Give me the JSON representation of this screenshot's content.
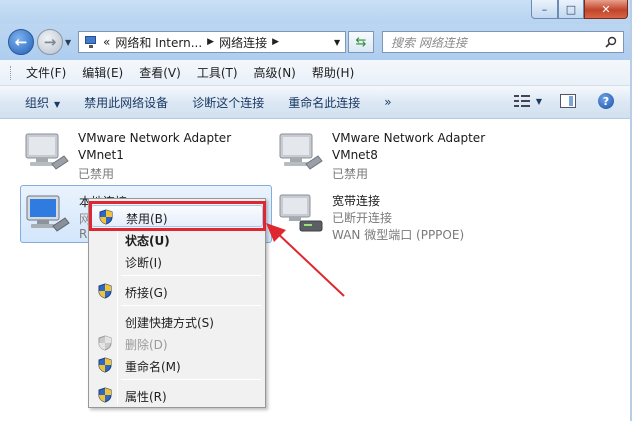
{
  "window": {
    "min_glyph": "–",
    "max_glyph": "□",
    "close_glyph": "✕"
  },
  "address": {
    "prefix": "«",
    "crumbs": [
      "网络和 Intern...",
      "网络连接"
    ],
    "search_placeholder": "搜索 网络连接"
  },
  "menu": {
    "items": [
      "文件(F)",
      "编辑(E)",
      "查看(V)",
      "工具(T)",
      "高级(N)",
      "帮助(H)"
    ]
  },
  "toolbar": {
    "organize": "组织",
    "disable_device": "禁用此网络设备",
    "diagnose": "诊断这个连接",
    "rename": "重命名此连接",
    "more": "»",
    "help": "?"
  },
  "connections": [
    {
      "name": "VMware Network Adapter",
      "line2": "VMnet1",
      "status": "已禁用"
    },
    {
      "name": "VMware Network Adapter",
      "line2": "VMnet8",
      "status": "已禁用"
    },
    {
      "name": "本地连接",
      "line2": "网",
      "status": "R"
    },
    {
      "name": "宽带连接",
      "line2": "已断开连接",
      "status": "WAN 微型端口 (PPPOE)"
    }
  ],
  "context_menu": {
    "items": [
      {
        "label": "禁用(B)",
        "shield": true,
        "bold": false,
        "disabled": false
      },
      {
        "label": "状态(U)",
        "shield": false,
        "bold": true,
        "disabled": false
      },
      {
        "label": "诊断(I)",
        "shield": false,
        "bold": false,
        "disabled": false
      },
      {
        "label": "桥接(G)",
        "shield": true,
        "bold": false,
        "disabled": false
      },
      {
        "label": "创建快捷方式(S)",
        "shield": false,
        "bold": false,
        "disabled": false
      },
      {
        "label": "删除(D)",
        "shield": true,
        "bold": false,
        "disabled": true
      },
      {
        "label": "重命名(M)",
        "shield": true,
        "bold": false,
        "disabled": false
      },
      {
        "label": "属性(R)",
        "shield": true,
        "bold": false,
        "disabled": false
      }
    ]
  },
  "annotation": {
    "color": "#e0262e"
  }
}
